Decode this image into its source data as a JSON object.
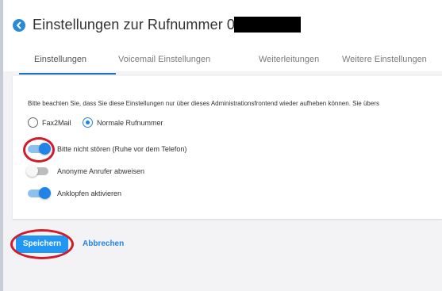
{
  "header": {
    "title": "Einstellungen zur Rufnummer 01"
  },
  "tabs": [
    {
      "label": "Einstellungen",
      "active": true
    },
    {
      "label": "Voicemail Einstellungen",
      "active": false
    },
    {
      "label": "Weiterleitungen",
      "active": false
    },
    {
      "label": "Weitere Einstellungen",
      "active": false
    }
  ],
  "settings": {
    "notice": "Bitte beachten Sie, dass Sie diese Einstellungen nur über dieses Administrationsfrontend wieder aufheben können. Sie übers",
    "mode_options": [
      {
        "label": "Fax2Mail",
        "selected": false
      },
      {
        "label": "Normale Rufnummer",
        "selected": true
      }
    ],
    "toggles": [
      {
        "label": "Bitte nicht stören (Ruhe vor dem Telefon)",
        "on": true
      },
      {
        "label": "Anonyme Anrufer abweisen",
        "on": false
      },
      {
        "label": "Anklopfen aktivieren",
        "on": true
      }
    ]
  },
  "actions": {
    "save_label": "Speichern",
    "cancel_label": "Abbrechen"
  },
  "colors": {
    "accent": "#2196f3",
    "annotation": "#d11a2a"
  }
}
